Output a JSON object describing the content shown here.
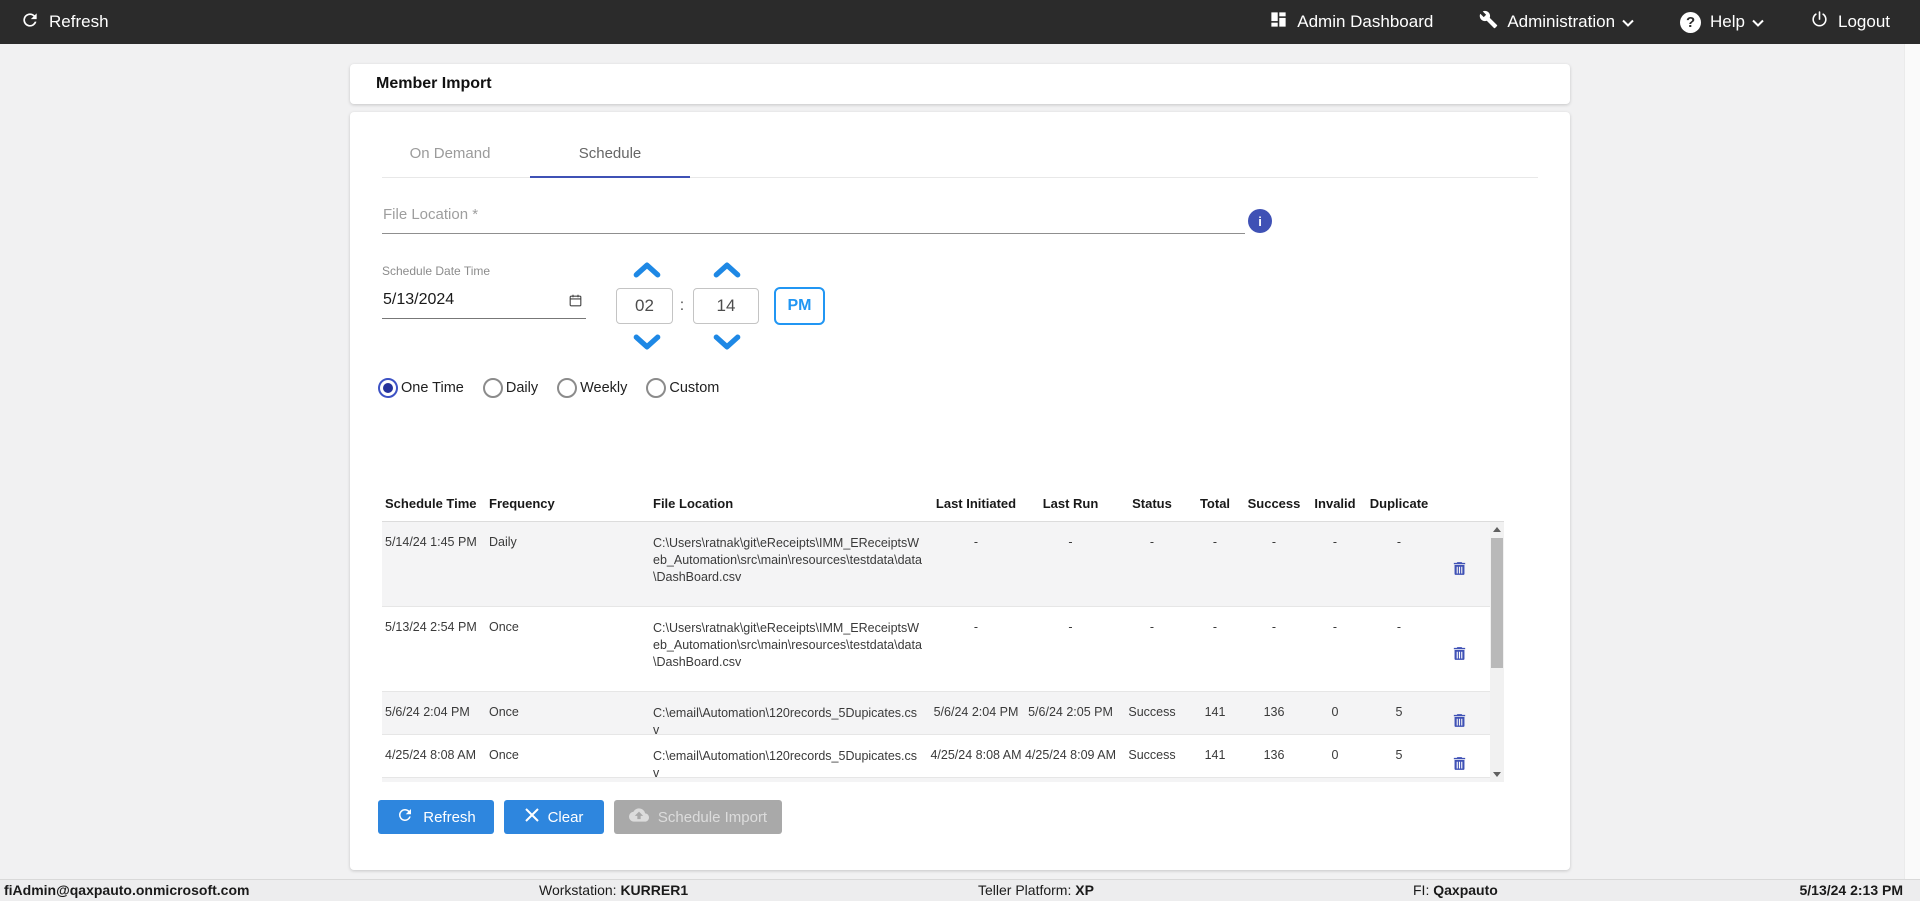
{
  "topbar": {
    "refresh": "Refresh",
    "admin_dashboard": "Admin Dashboard",
    "administration": "Administration",
    "help": "Help",
    "logout": "Logout"
  },
  "page": {
    "title": "Member Import"
  },
  "tabs": [
    {
      "label": "On Demand",
      "active": false
    },
    {
      "label": "Schedule",
      "active": true
    }
  ],
  "form": {
    "file_location": {
      "placeholder": "File Location *",
      "value": ""
    },
    "schedule_date_time": {
      "label": "Schedule Date Time",
      "value": "5/13/2024"
    },
    "time": {
      "hour": "02",
      "minute": "14",
      "separator": ":",
      "meridiem": "PM"
    },
    "frequency_options": [
      {
        "label": "One Time",
        "selected": true
      },
      {
        "label": "Daily",
        "selected": false
      },
      {
        "label": "Weekly",
        "selected": false
      },
      {
        "label": "Custom",
        "selected": false
      }
    ]
  },
  "table": {
    "columns": [
      "Schedule Time",
      "Frequency",
      "File Location",
      "Last Initiated",
      "Last Run",
      "Status",
      "Total",
      "Success",
      "Invalid",
      "Duplicate"
    ],
    "rows": [
      {
        "schedule_time": "5/14/24 1:45 PM",
        "frequency": "Daily",
        "file_location": "C:\\Users\\ratnak\\git\\eReceipts\\IMM_EReceiptsWeb_Automation\\src\\main\\resources\\testdata\\data\\DashBoard.csv",
        "last_initiated": "-",
        "last_run": "-",
        "status": "-",
        "total": "-",
        "success": "-",
        "invalid": "-",
        "duplicate": "-"
      },
      {
        "schedule_time": "5/13/24 2:54 PM",
        "frequency": "Once",
        "file_location": "C:\\Users\\ratnak\\git\\eReceipts\\IMM_EReceiptsWeb_Automation\\src\\main\\resources\\testdata\\data\\DashBoard.csv",
        "last_initiated": "-",
        "last_run": "-",
        "status": "-",
        "total": "-",
        "success": "-",
        "invalid": "-",
        "duplicate": "-"
      },
      {
        "schedule_time": "5/6/24 2:04 PM",
        "frequency": "Once",
        "file_location": "C:\\email\\Automation\\120records_5Dupicates.csv",
        "last_initiated": "5/6/24 2:04 PM",
        "last_run": "5/6/24 2:05 PM",
        "status": "Success",
        "total": "141",
        "success": "136",
        "invalid": "0",
        "duplicate": "5"
      },
      {
        "schedule_time": "4/25/24 8:08 AM",
        "frequency": "Once",
        "file_location": "C:\\email\\Automation\\120records_5Dupicates.csv",
        "last_initiated": "4/25/24 8:08 AM",
        "last_run": "4/25/24 8:09 AM",
        "status": "Success",
        "total": "141",
        "success": "136",
        "invalid": "0",
        "duplicate": "5"
      }
    ]
  },
  "actions": {
    "refresh": "Refresh",
    "clear": "Clear",
    "schedule_import": "Schedule Import"
  },
  "footer": {
    "user": "fiAdmin@qaxpauto.onmicrosoft.com",
    "workstation_label": "Workstation:",
    "workstation_value": "KURRER1",
    "teller_label": "Teller Platform:",
    "teller_value": "XP",
    "fi_label": "FI:",
    "fi_value": "Qaxpauto",
    "datetime": "5/13/24 2:13 PM"
  },
  "colors": {
    "topbar_bg": "#2b2b2b",
    "primary_blue": "#2e86de",
    "indigo_accent": "#3f51b5",
    "spinner_blue": "#2196f3"
  }
}
